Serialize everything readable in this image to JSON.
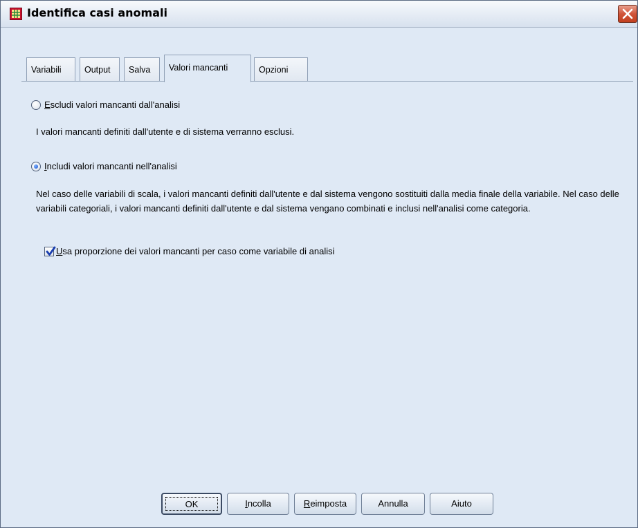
{
  "window": {
    "title": "Identifica casi anomali",
    "icon": "grid-table-icon",
    "close_icon": "close-icon"
  },
  "tabs": [
    {
      "label": "Variabili",
      "active": false
    },
    {
      "label": "Output",
      "active": false
    },
    {
      "label": "Salva",
      "active": false
    },
    {
      "label": "Valori mancanti",
      "active": true
    },
    {
      "label": "Opzioni",
      "active": false
    }
  ],
  "options": {
    "exclude": {
      "label_mnemonic": "E",
      "label_rest": "scludi valori mancanti dall'analisi",
      "selected": false,
      "description": "I valori mancanti definiti dall'utente e di sistema verranno esclusi."
    },
    "include": {
      "label_mnemonic": "I",
      "label_rest": "ncludi valori mancanti nell'analisi",
      "selected": true,
      "description": "Nel caso delle variabili di scala, i valori mancanti definiti dall'utente e dal sistema vengono sostituiti dalla media finale della variabile. Nel caso delle variabili categoriali, i valori mancanti definiti dall'utente e dal sistema vengano combinati e inclusi nell'analisi come categoria."
    },
    "use_proportion": {
      "label_mnemonic": "U",
      "label_rest": "sa proporzione dei valori mancanti per caso come variabile di analisi",
      "checked": true
    }
  },
  "buttons": {
    "ok": "OK",
    "paste_mnemonic": "I",
    "paste_rest": "ncolla",
    "reset_mnemonic": "R",
    "reset_rest": "eimposta",
    "cancel": "Annulla",
    "help": "Aiuto"
  },
  "colors": {
    "background": "#dfe9f5",
    "accent": "#1048c8"
  }
}
